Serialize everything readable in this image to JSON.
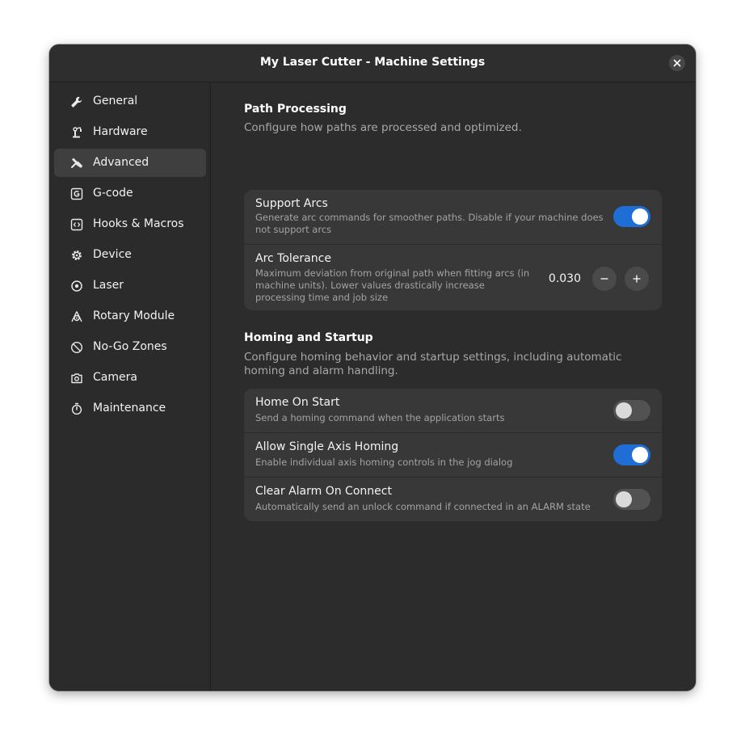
{
  "window": {
    "title": "My Laser Cutter - Machine Settings"
  },
  "sidebar": {
    "items": [
      {
        "label": "General",
        "icon": "wrench-icon",
        "active": false
      },
      {
        "label": "Hardware",
        "icon": "robot-arm-icon",
        "active": false
      },
      {
        "label": "Advanced",
        "icon": "tools-icon",
        "active": true
      },
      {
        "label": "G-code",
        "icon": "gcode-icon",
        "active": false
      },
      {
        "label": "Hooks & Macros",
        "icon": "code-icon",
        "active": false
      },
      {
        "label": "Device",
        "icon": "gear-icon",
        "active": false
      },
      {
        "label": "Laser",
        "icon": "target-icon",
        "active": false
      },
      {
        "label": "Rotary Module",
        "icon": "rotary-icon",
        "active": false
      },
      {
        "label": "No-Go Zones",
        "icon": "no-entry-icon",
        "active": false
      },
      {
        "label": "Camera",
        "icon": "camera-icon",
        "active": false
      },
      {
        "label": "Maintenance",
        "icon": "stopwatch-icon",
        "active": false
      }
    ]
  },
  "path_processing": {
    "title": "Path Processing",
    "description": "Configure how paths are processed and optimized.",
    "support_arcs": {
      "title": "Support Arcs",
      "subtitle": "Generate arc commands for smoother paths. Disable if your machine does not support arcs",
      "enabled": true
    },
    "arc_tolerance": {
      "title": "Arc Tolerance",
      "subtitle": "Maximum deviation from original path when fitting arcs (in machine units). Lower values drastically increase processing time and job size",
      "value": "0.030"
    }
  },
  "homing": {
    "title": "Homing and Startup",
    "description": "Configure homing behavior and startup settings, including automatic homing and alarm handling.",
    "home_on_start": {
      "title": "Home On Start",
      "subtitle": "Send a homing command when the application starts",
      "enabled": false
    },
    "single_axis": {
      "title": "Allow Single Axis Homing",
      "subtitle": "Enable individual axis homing controls in the jog dialog",
      "enabled": true
    },
    "clear_alarm": {
      "title": "Clear Alarm On Connect",
      "subtitle": "Automatically send an unlock command if connected in an ALARM state",
      "enabled": false
    }
  },
  "colors": {
    "accent": "#1f6ed6",
    "window_bg": "#2c2c2c",
    "card_bg": "#383838"
  }
}
